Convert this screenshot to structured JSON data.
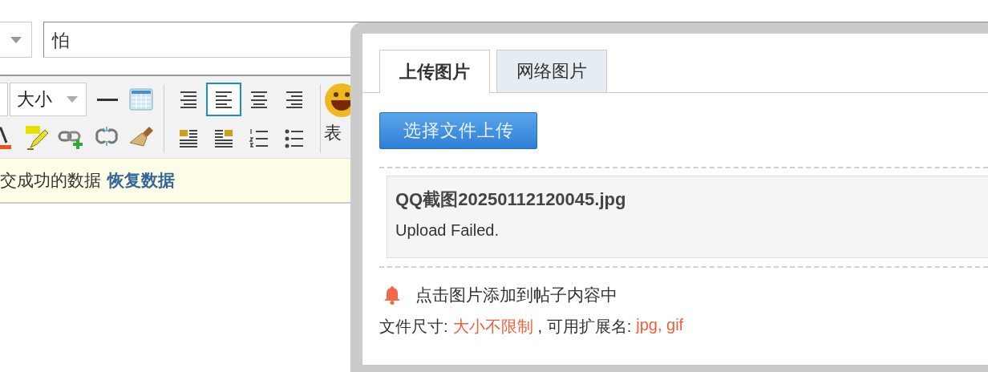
{
  "title_input": {
    "value": "怕"
  },
  "toolbar": {
    "size_select": "大小",
    "row1": [
      {
        "kind": "hr",
        "selected": false
      },
      {
        "kind": "table",
        "selected": false
      }
    ],
    "row2": [
      {
        "kind": "fontcolor",
        "selected": false
      },
      {
        "kind": "highlight",
        "selected": false
      },
      {
        "kind": "link",
        "selected": false
      },
      {
        "kind": "unlink",
        "selected": false
      },
      {
        "kind": "eraser",
        "selected": false
      }
    ],
    "align_row1": [
      {
        "kind": "align-justify",
        "selected": false
      },
      {
        "kind": "align-left",
        "selected": true
      },
      {
        "kind": "align-center",
        "selected": false
      },
      {
        "kind": "align-right",
        "selected": false
      }
    ],
    "align_row2": [
      {
        "kind": "float-left",
        "selected": false
      },
      {
        "kind": "float-right",
        "selected": false
      },
      {
        "kind": "ordered-list",
        "selected": false
      },
      {
        "kind": "bullet-list",
        "selected": false
      }
    ],
    "emoji_label": "表"
  },
  "notice": {
    "text": "交成功的数据",
    "link": "恢复数据"
  },
  "dialog": {
    "tabs": [
      {
        "label": "上传图片",
        "selected": true
      },
      {
        "label": "网络图片",
        "selected": false
      }
    ],
    "upload_button": "选择文件上传",
    "file": {
      "name": "QQ截图20250112120045.jpg",
      "status": "Upload Failed."
    },
    "hint": "点击图片添加到帖子内容中",
    "size_label": "文件尺寸:",
    "size_value": "大小不限制",
    "ext_label": ", 可用扩展名:",
    "ext_value": "jpg, gif"
  }
}
